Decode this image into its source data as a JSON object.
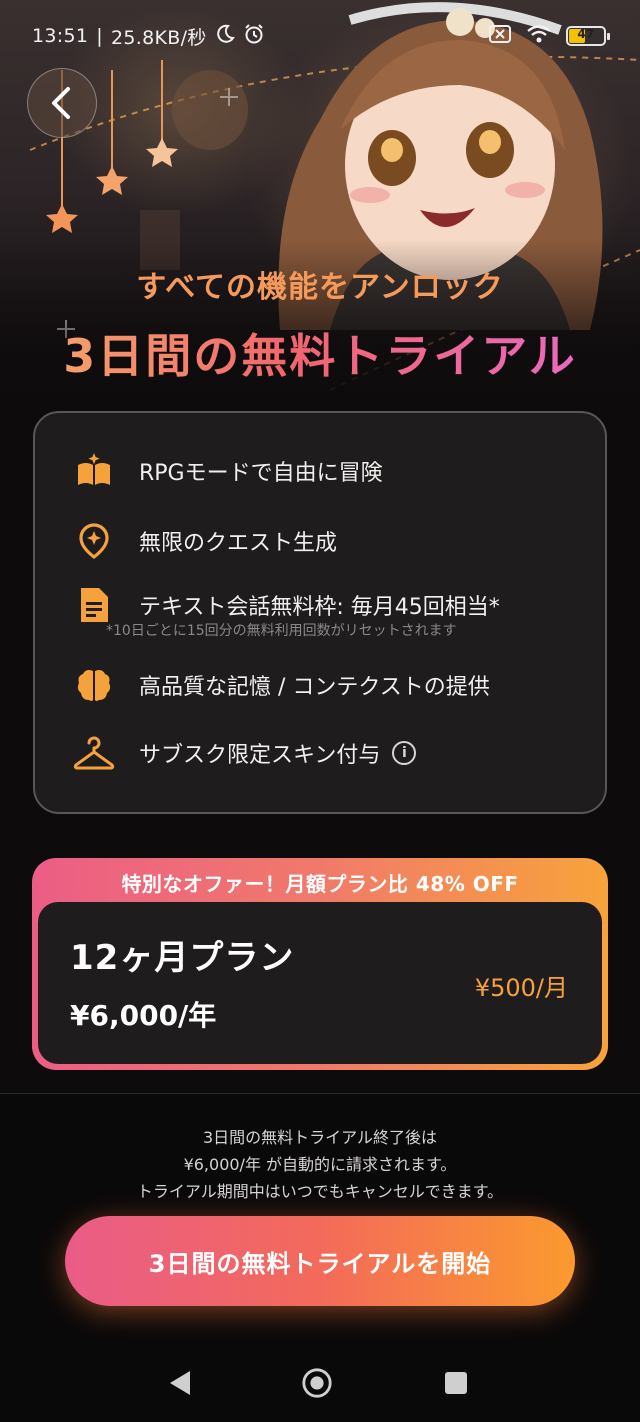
{
  "status_bar": {
    "time": "13:51",
    "separator": "|",
    "net_speed": "25.8KB/秒",
    "battery": "47",
    "icons": [
      "moon-icon",
      "alarm-icon",
      "sim-off-icon",
      "wifi-icon",
      "battery-icon"
    ]
  },
  "header": {
    "back_icon": "chevron-left-icon",
    "subtitle": "すべての機能をアンロック",
    "title": "3日間の無料トライアル"
  },
  "features": {
    "items": [
      {
        "icon": "book-sparkle-icon",
        "label": "RPGモードで自由に冒険"
      },
      {
        "icon": "quest-pin-icon",
        "label": "無限のクエスト生成"
      },
      {
        "icon": "document-icon",
        "label": "テキスト会話無料枠: 毎月45回相当*"
      },
      {
        "icon": "brain-icon",
        "label": "高品質な記憶 / コンテクストの提供"
      },
      {
        "icon": "hanger-icon",
        "label": "サブスク限定スキン付与"
      }
    ],
    "note": "*10日ごとに15回分の無料利用回数がリセットされます",
    "info_glyph": "i"
  },
  "offer": {
    "banner": "特別なオファー！月額プラン比 48% OFF",
    "plan_name": "12ヶ月プラン",
    "price": "¥6,000/年",
    "monthly": "¥500/月"
  },
  "footer": {
    "notice_line1": "3日間の無料トライアル終了後は",
    "notice_line2": "¥6,000/年 が自動的に請求されます。",
    "notice_line3": "トライアル期間中はいつでもキャンセルできます。",
    "cta_label": "3日間の無料トライアルを開始"
  },
  "colors": {
    "accent_orange": "#f5a23c",
    "gradient_pink": "#ea5c88",
    "gradient_orange": "#fb9a2e",
    "card_bg": "#1f1c1d"
  }
}
